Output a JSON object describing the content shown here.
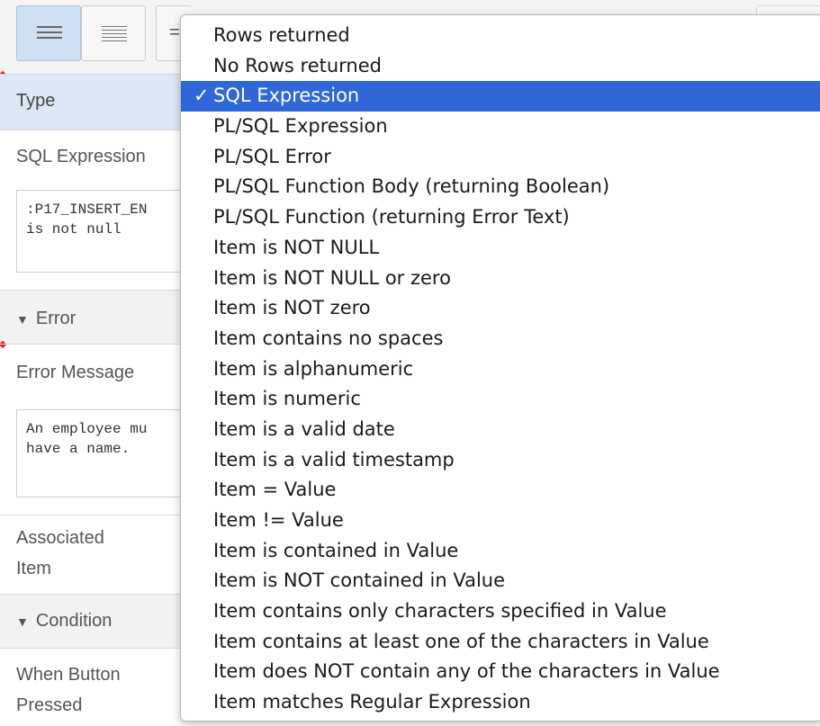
{
  "panel": {
    "type_label": "Type",
    "sql_expression_label": "SQL Expression",
    "sql_expression_value": ":P17_INSERT_EN\nis not null",
    "error_section": "Error",
    "error_message_label": "Error Message",
    "error_message_value": "An employee mu\nhave a name.",
    "associated_item_label": "Associated\nItem",
    "condition_section": "Condition",
    "when_button_pressed_label": "When Button\nPressed"
  },
  "dropdown": {
    "check_glyph": "✓",
    "selected_index": 2,
    "options": [
      "Rows returned",
      "No Rows returned",
      "SQL Expression",
      "PL/SQL Expression",
      "PL/SQL Error",
      "PL/SQL Function Body (returning Boolean)",
      "PL/SQL Function (returning Error Text)",
      "Item is NOT NULL",
      "Item is NOT NULL or zero",
      "Item is NOT zero",
      "Item contains no spaces",
      "Item is alphanumeric",
      "Item is numeric",
      "Item is a valid date",
      "Item is a valid timestamp",
      "Item = Value",
      "Item != Value",
      "Item is contained in Value",
      "Item is NOT contained in Value",
      "Item contains only characters specified in Value",
      "Item contains at least one of the characters in Value",
      "Item does NOT contain any of the characters in Value",
      "Item matches Regular Expression"
    ]
  },
  "colors": {
    "selected_bg": "#2f67d8",
    "type_row_bg": "#dce8f5",
    "active_toolbar_btn": "#cfe0f3"
  },
  "icons": [
    "list-view-icon",
    "dense-list-view-icon",
    "overflow-icon"
  ]
}
